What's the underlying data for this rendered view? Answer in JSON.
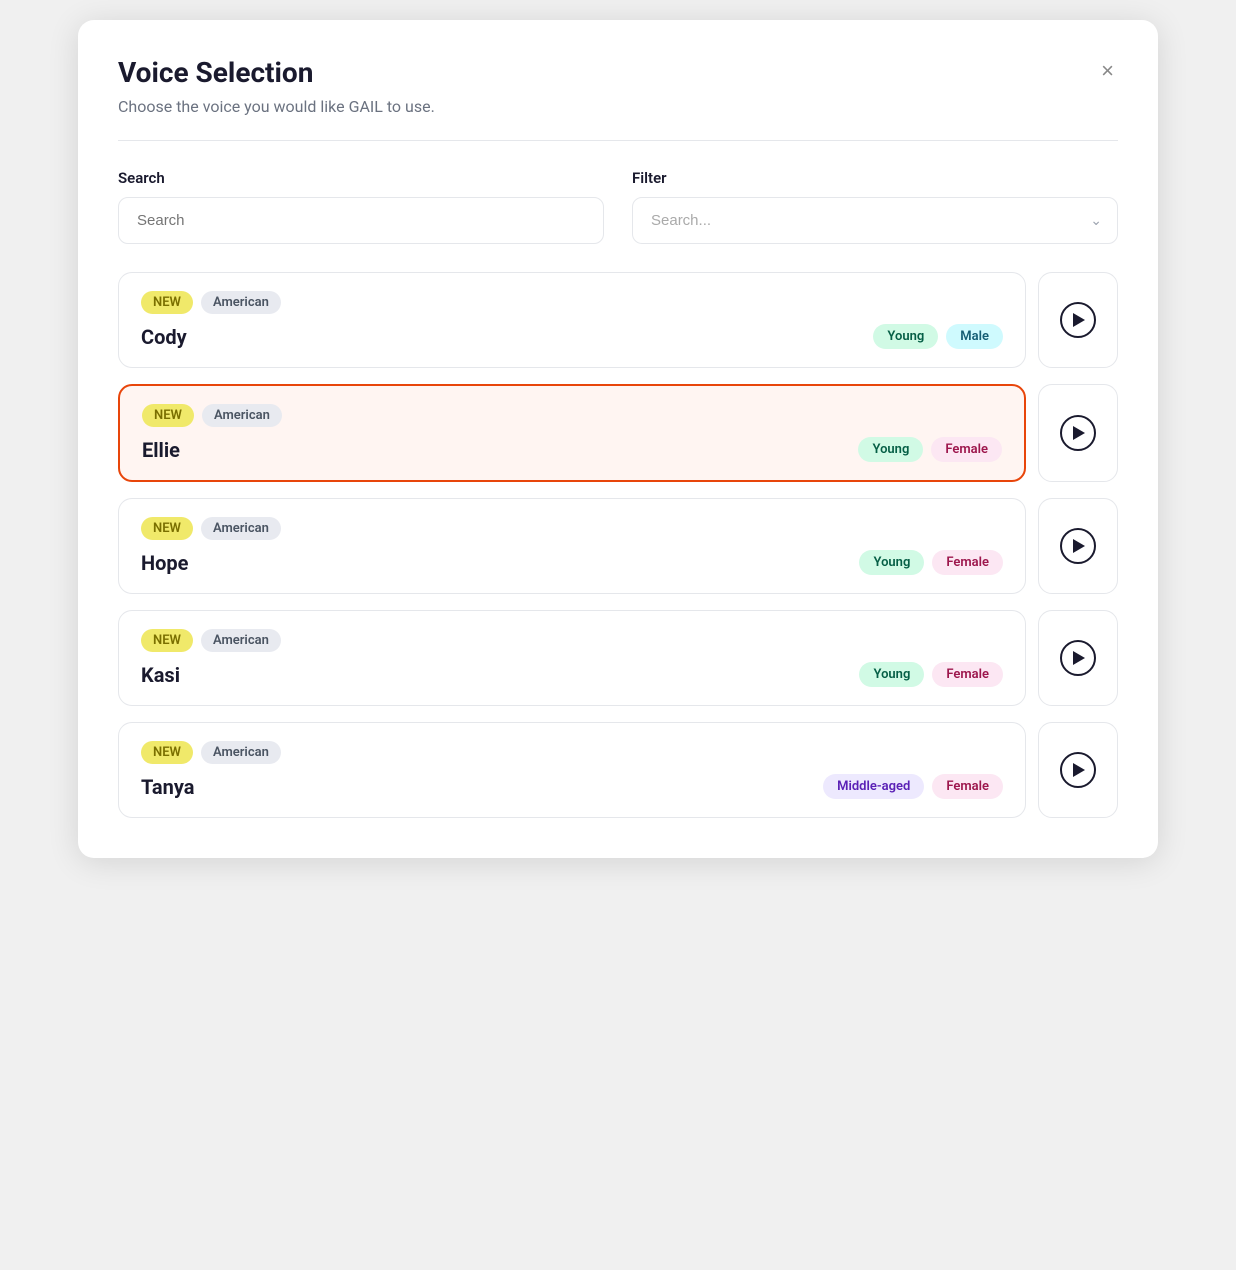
{
  "modal": {
    "title": "Voice Selection",
    "subtitle": "Choose the voice you would like GAIL to use.",
    "close_label": "×"
  },
  "search": {
    "label": "Search",
    "placeholder": "Search"
  },
  "filter": {
    "label": "Filter",
    "placeholder": "Search..."
  },
  "voices": [
    {
      "id": "cody",
      "name": "Cody",
      "tag_new": "NEW",
      "tag_accent": "American",
      "attr_age": "Young",
      "attr_age_class": "attr-young",
      "attr_gender": "Male",
      "attr_gender_class": "attr-male",
      "selected": false
    },
    {
      "id": "ellie",
      "name": "Ellie",
      "tag_new": "NEW",
      "tag_accent": "American",
      "attr_age": "Young",
      "attr_age_class": "attr-young",
      "attr_gender": "Female",
      "attr_gender_class": "attr-female",
      "selected": true
    },
    {
      "id": "hope",
      "name": "Hope",
      "tag_new": "NEW",
      "tag_accent": "American",
      "attr_age": "Young",
      "attr_age_class": "attr-young",
      "attr_gender": "Female",
      "attr_gender_class": "attr-female",
      "selected": false
    },
    {
      "id": "kasi",
      "name": "Kasi",
      "tag_new": "NEW",
      "tag_accent": "American",
      "attr_age": "Young",
      "attr_age_class": "attr-young",
      "attr_gender": "Female",
      "attr_gender_class": "attr-female",
      "selected": false
    },
    {
      "id": "tanya",
      "name": "Tanya",
      "tag_new": "NEW",
      "tag_accent": "American",
      "attr_age": "Middle-aged",
      "attr_age_class": "attr-middle-aged",
      "attr_gender": "Female",
      "attr_gender_class": "attr-female",
      "selected": false
    }
  ]
}
